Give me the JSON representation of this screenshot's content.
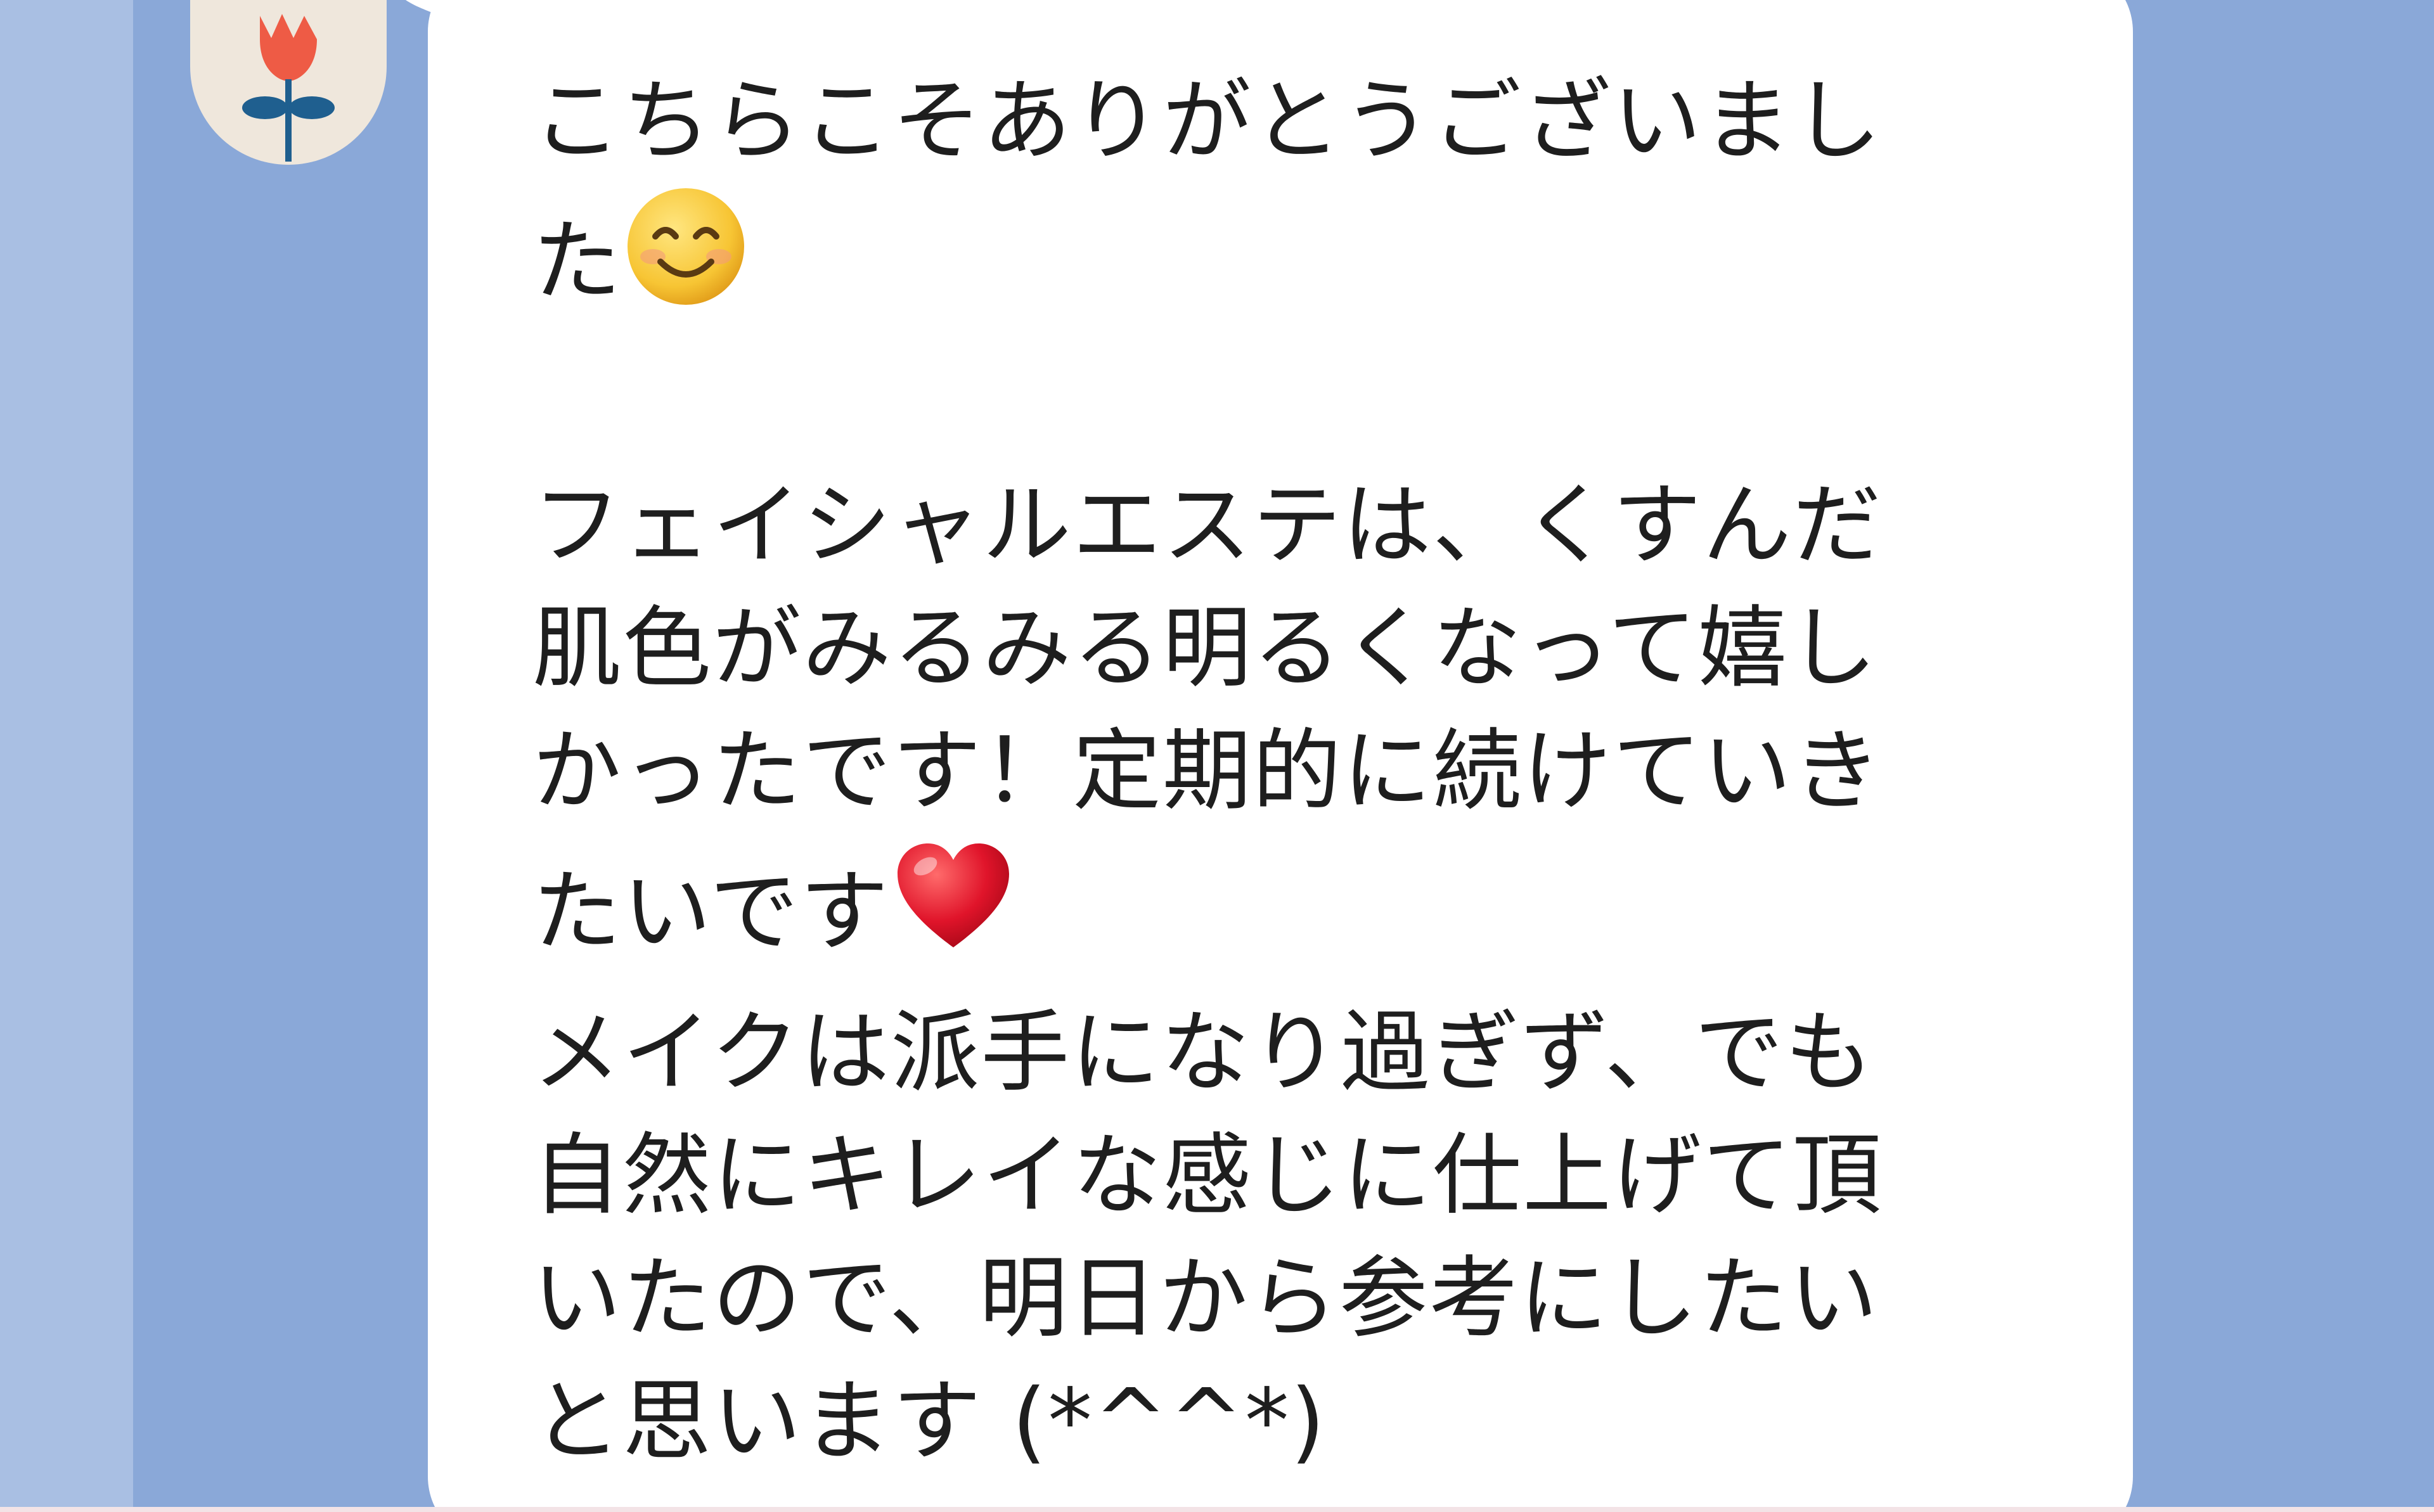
{
  "colors": {
    "chat_background": "#8aa8d8",
    "bubble": "#ffffff",
    "text": "#1e1e1e",
    "avatar_bg": "#efe7dc",
    "tulip_red": "#ee5b45",
    "tulip_stem": "#1f5f8f"
  },
  "message": {
    "line1": "こちらこそありがとうございまし",
    "line2": "た",
    "emoji_1": "smiling-face-icon",
    "para2_line1": "フェイシャルエステは、くすんだ",
    "para2_line2": "肌色がみるみる明るくなって嬉し",
    "para2_line3": "かったです！定期的に続けていき",
    "para2_line4": "たいです",
    "emoji_2": "red-heart-icon",
    "para3_line1": "メイクは派手になり過ぎず、でも",
    "para3_line2": "自然にキレイな感じに仕上げて頂",
    "para3_line3": "いたので、明日から参考にしたい",
    "para3_line4": "と思います (*^^*)"
  },
  "avatar": {
    "icon": "tulip-icon"
  }
}
